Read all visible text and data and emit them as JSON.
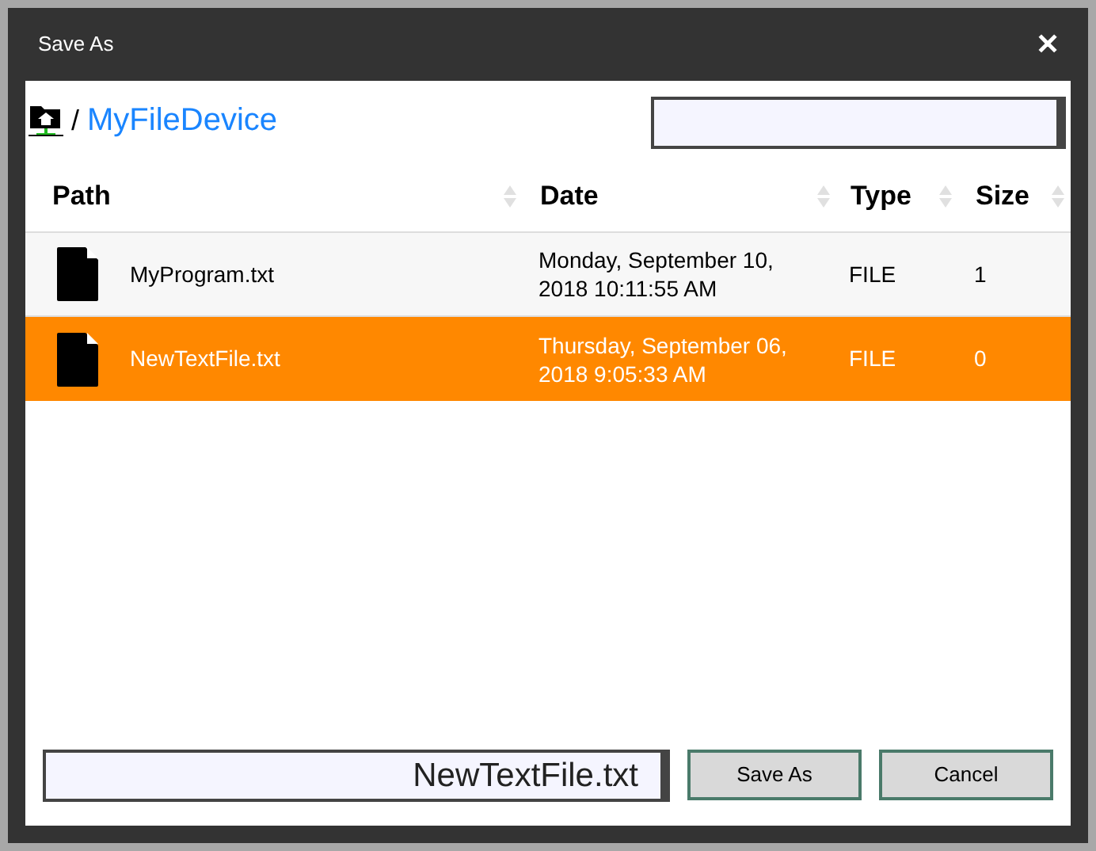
{
  "window": {
    "title": "Save As",
    "close": "✕"
  },
  "breadcrumb": {
    "separator": "/",
    "location": "MyFileDevice"
  },
  "table": {
    "columns": [
      "Path",
      "Date",
      "Type",
      "Size"
    ],
    "rows": [
      {
        "name": "MyProgram.txt",
        "date": "Monday, September 10, 2018 10:11:55 AM",
        "type": "FILE",
        "size": "1",
        "selected": false
      },
      {
        "name": "NewTextFile.txt",
        "date": "Thursday, September 06, 2018 9:05:33 AM",
        "type": "FILE",
        "size": "0",
        "selected": true
      }
    ]
  },
  "filename": {
    "value": "NewTextFile.txt"
  },
  "buttons": [
    "Save As",
    "Cancel"
  ]
}
